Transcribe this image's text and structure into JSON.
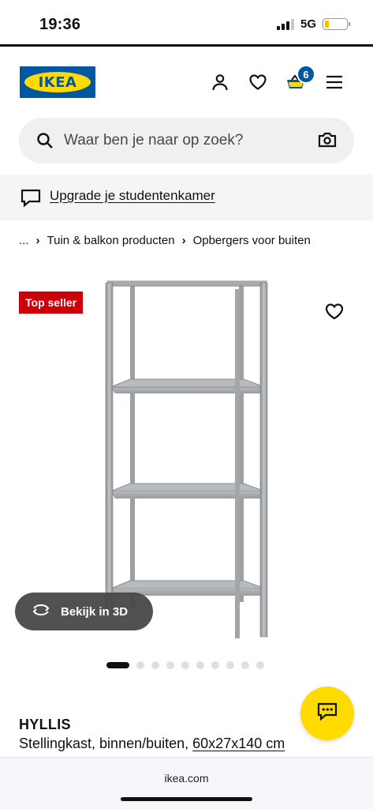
{
  "status_bar": {
    "time": "19:36",
    "network": "5G",
    "signal_bars": 3,
    "battery_level": 0.18,
    "battery_color": "#f2c200"
  },
  "header": {
    "logo_text": "IKEA",
    "icons": [
      "user-icon",
      "heart-icon",
      "basket-icon",
      "menu-icon"
    ],
    "cart_count": "6",
    "brand_blue": "#0058a3",
    "brand_yellow": "#ffdb00"
  },
  "search": {
    "placeholder": "Waar ben je naar op zoek?",
    "value": ""
  },
  "promo": {
    "icon": "chat-bubble-icon",
    "label": "Upgrade je studentenkamer"
  },
  "breadcrumb": {
    "items": [
      "...",
      "Tuin & balkon producten",
      "Opbergers voor buiten"
    ]
  },
  "product": {
    "badge": "Top seller",
    "badge_color": "#cc0008",
    "view_3d_label": "Bekijk in 3D",
    "image_count": 10,
    "active_image": 1,
    "name": "HYLLIS",
    "description": "Stellingkast, binnen/buiten, ",
    "size": "60x27x140 cm"
  },
  "browser": {
    "url": "ikea.com"
  }
}
